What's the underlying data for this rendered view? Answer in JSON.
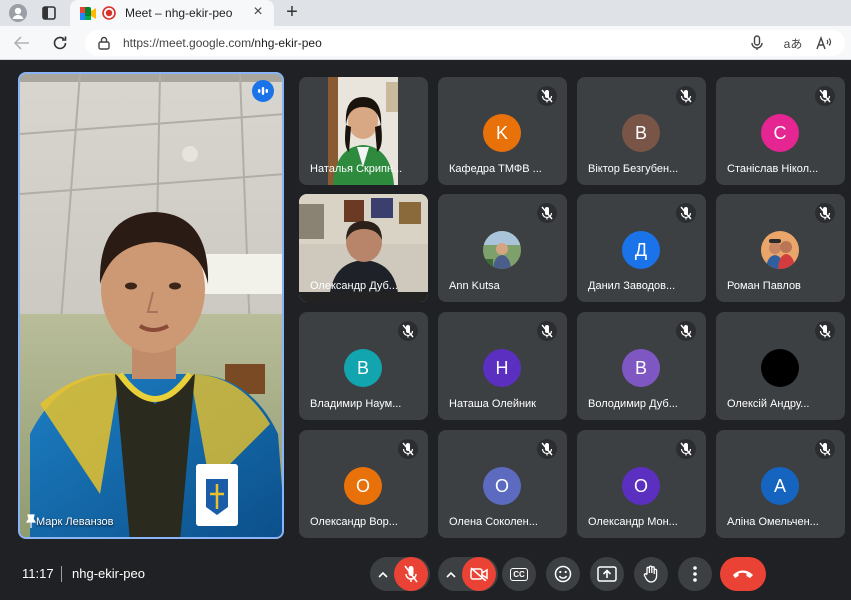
{
  "browser": {
    "tab_title": "Meet – nhg-ekir-peo",
    "url_host": "https://meet.google.com",
    "url_path": "/nhg-ekir-peo",
    "new_tab_symbol": "+",
    "close_symbol": "×",
    "translate_label": "aあ"
  },
  "main_speaker": {
    "name": "Марк Леванзов"
  },
  "participants": [
    {
      "name": "Наталья Скрипн...",
      "type": "video"
    },
    {
      "name": "Кафедра ТМФВ ...",
      "initial": "K",
      "color": "#e8710a"
    },
    {
      "name": "Віктор Безгубен...",
      "initial": "B",
      "color": "#795548"
    },
    {
      "name": "Станіслав Нікол...",
      "initial": "C",
      "color": "#e52592"
    },
    {
      "name": "Олександр Дуб...",
      "type": "video"
    },
    {
      "name": "Ann Kutsa",
      "type": "photo"
    },
    {
      "name": "Данил Заводов...",
      "initial": "Д",
      "color": "#1a73e8"
    },
    {
      "name": "Роман Павлов",
      "type": "photo"
    },
    {
      "name": "Владимир Наум...",
      "initial": "B",
      "color": "#12a4af"
    },
    {
      "name": "Наташа Олейник",
      "initial": "H",
      "color": "#5b2fbf"
    },
    {
      "name": "Володимир Дуб...",
      "initial": "B",
      "color": "#7e57c2"
    },
    {
      "name": "Олексій Андру...",
      "initial": "",
      "color": "#000000"
    },
    {
      "name": "Олександр Вор...",
      "initial": "O",
      "color": "#e8710a"
    },
    {
      "name": "Олена Соколен...",
      "initial": "O",
      "color": "#5c6bc0"
    },
    {
      "name": "Олександр Мон...",
      "initial": "O",
      "color": "#5b2fbf"
    },
    {
      "name": "Аліна Омельчен...",
      "initial": "A",
      "color": "#1565c0"
    }
  ],
  "meeting": {
    "time": "11:17",
    "code": "nhg-ekir-peo"
  },
  "controls": {
    "cc_label": "CC"
  }
}
